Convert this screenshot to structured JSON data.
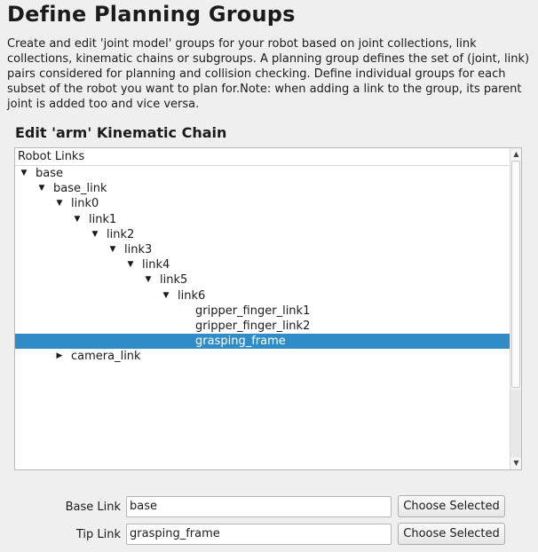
{
  "page": {
    "title": "Define Planning Groups",
    "description": "Create and edit 'joint model' groups for your robot based on joint collections, link collections, kinematic chains or subgroups. A planning group defines the set of (joint, link) pairs considered for planning and collision checking. Define individual groups for each subset of the robot you want to plan for.Note: when adding a link to the group, its parent joint is added too and vice versa."
  },
  "section_title": "Edit 'arm' Kinematic Chain",
  "tree": {
    "header": "Robot Links",
    "rows": [
      {
        "label": "base",
        "level": 0,
        "expander": "expanded",
        "selected": false
      },
      {
        "label": "base_link",
        "level": 1,
        "expander": "expanded",
        "selected": false
      },
      {
        "label": "link0",
        "level": 2,
        "expander": "expanded",
        "selected": false
      },
      {
        "label": "link1",
        "level": 3,
        "expander": "expanded",
        "selected": false
      },
      {
        "label": "link2",
        "level": 4,
        "expander": "expanded",
        "selected": false
      },
      {
        "label": "link3",
        "level": 5,
        "expander": "expanded",
        "selected": false
      },
      {
        "label": "link4",
        "level": 6,
        "expander": "expanded",
        "selected": false
      },
      {
        "label": "link5",
        "level": 7,
        "expander": "expanded",
        "selected": false
      },
      {
        "label": "link6",
        "level": 8,
        "expander": "expanded",
        "selected": false
      },
      {
        "label": "gripper_finger_link1",
        "level": 9,
        "expander": "none",
        "selected": false
      },
      {
        "label": "gripper_finger_link2",
        "level": 9,
        "expander": "none",
        "selected": false
      },
      {
        "label": "grasping_frame",
        "level": 9,
        "expander": "none",
        "selected": true
      },
      {
        "label": "camera_link",
        "level": 2,
        "expander": "collapsed",
        "selected": false
      }
    ]
  },
  "form": {
    "base_link_label": "Base Link",
    "base_link_value": "base",
    "tip_link_label": "Tip Link",
    "tip_link_value": "grasping_frame",
    "choose_selected_label": "Choose Selected"
  },
  "colors": {
    "selection": "#308cc6",
    "background": "#efefef"
  },
  "icons": {
    "expanded": "triangle-down-icon",
    "collapsed": "triangle-right-icon"
  }
}
